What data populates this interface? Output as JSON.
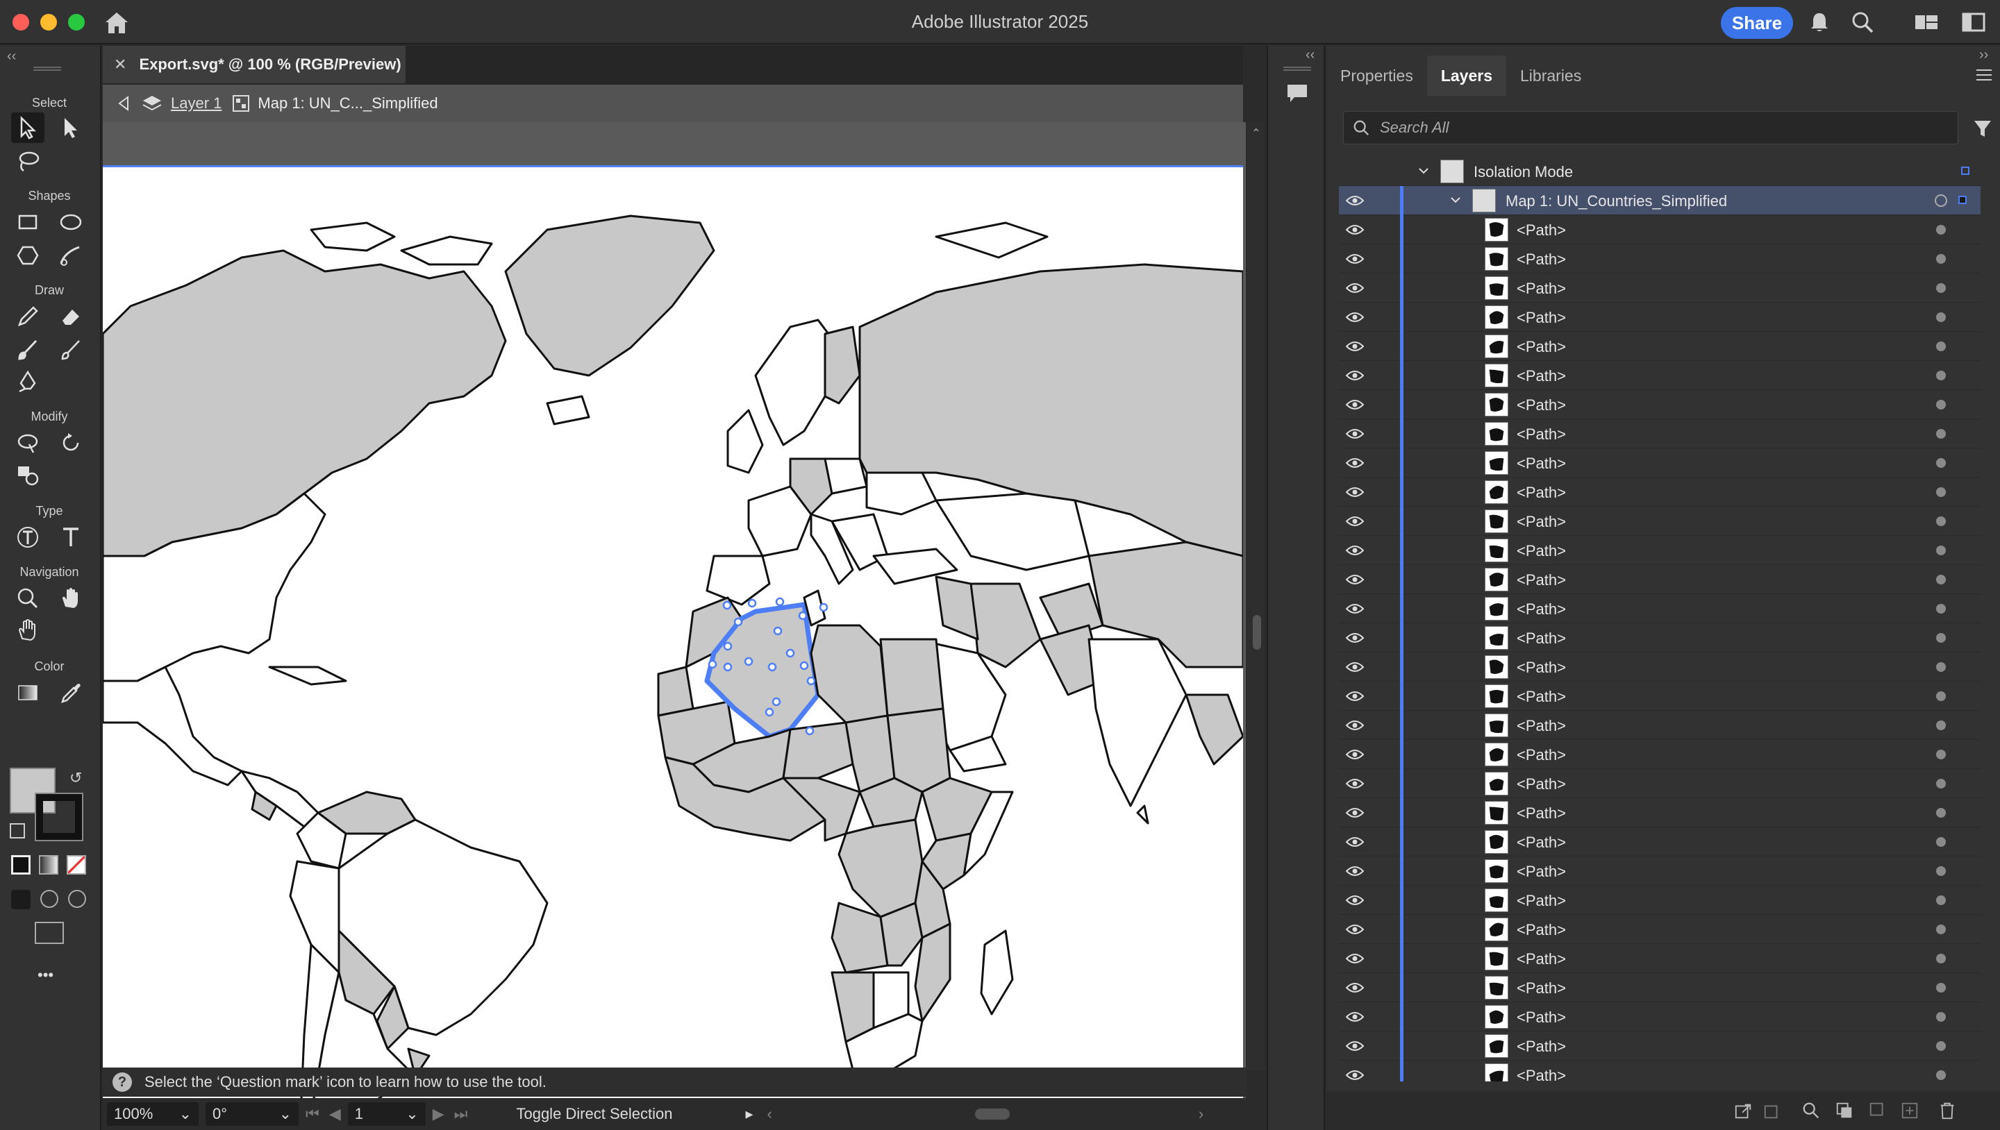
{
  "titlebar": {
    "title": "Adobe Illustrator 2025",
    "share_label": "Share"
  },
  "toolbar": {
    "sections": {
      "select": "Select",
      "shapes": "Shapes",
      "draw": "Draw",
      "modify": "Modify",
      "type": "Type",
      "navigation": "Navigation",
      "color": "Color"
    },
    "more": "•••"
  },
  "document": {
    "tab_title": "Export.svg* @ 100 % (RGB/Preview)",
    "isolation": {
      "layer": "Layer 1",
      "group": "Map 1: UN_C..._Simplified"
    },
    "help_text": "Select the ‘Question mark’ icon to learn how to use the tool.",
    "status": {
      "zoom": "100%",
      "rotation": "0°",
      "artboard": "1",
      "tool": "Toggle Direct Selection"
    }
  },
  "panel": {
    "tabs": [
      "Properties",
      "Layers",
      "Libraries"
    ],
    "active_tab": "Layers",
    "search_placeholder": "Search All",
    "isolation_label": "Isolation Mode",
    "group_label": "Map 1: UN_Countries_Simplified",
    "path_label": "<Path>",
    "path_count": 30
  },
  "colors": {
    "accent": "#4d7ef5",
    "share": "#3a74e8",
    "land": "#c8c8c8",
    "selection": "#4d7ef5"
  }
}
